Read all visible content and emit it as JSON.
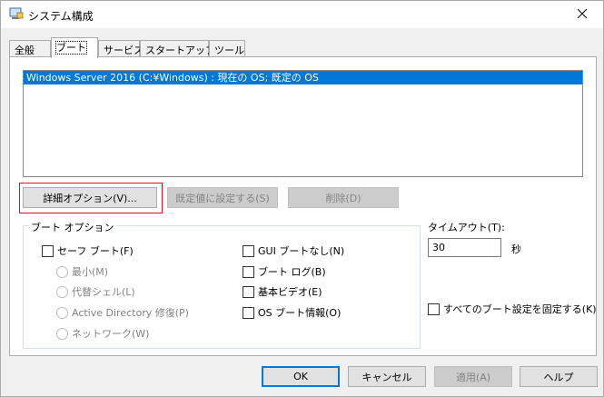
{
  "window": {
    "title": "システム構成"
  },
  "tabs": [
    {
      "label": "全般"
    },
    {
      "label": "ブート"
    },
    {
      "label": "サービス"
    },
    {
      "label": "スタートアップ"
    },
    {
      "label": "ツール"
    }
  ],
  "boot": {
    "os_list": [
      "Windows Server 2016 (C:¥Windows) : 現在の OS; 既定の OS"
    ],
    "advanced_options_label": "詳細オプション(V)...",
    "set_default_label": "既定値に設定する(S)",
    "delete_label": "削除(D)",
    "boot_options_title": "ブート オプション",
    "safe_boot_label": "セーフ ブート(F)",
    "safe_boot_modes": [
      {
        "label": "最小(M)"
      },
      {
        "label": "代替シェル(L)"
      },
      {
        "label": "Active Directory 修復(P)"
      },
      {
        "label": "ネットワーク(W)"
      }
    ],
    "no_gui_boot_label": "GUI ブートなし(N)",
    "boot_log_label": "ブート ログ(B)",
    "base_video_label": "基本ビデオ(E)",
    "os_boot_info_label": "OS ブート情報(O)",
    "timeout_label": "タイムアウト(T):",
    "timeout_value": "30",
    "timeout_unit": "秒",
    "make_permanent_label": "すべてのブート設定を固定する(K)"
  },
  "footer": {
    "ok_label": "OK",
    "cancel_label": "キャンセル",
    "apply_label": "適用(A)",
    "help_label": "ヘルプ"
  },
  "colors": {
    "selection": "#0078d7",
    "focus_highlight": "#e81123"
  }
}
